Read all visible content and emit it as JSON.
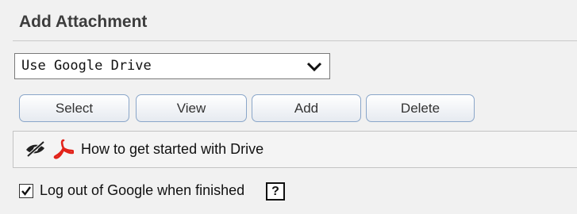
{
  "panel": {
    "title": "Add Attachment"
  },
  "source_select": {
    "value": "Use Google Drive",
    "icon": "chevron-down-icon"
  },
  "buttons": {
    "select": "Select",
    "view": "View",
    "add": "Add",
    "delete": "Delete"
  },
  "files": [
    {
      "name": "How to get started with Drive",
      "icons": [
        "eye-slash-icon",
        "pdf-icon"
      ]
    }
  ],
  "logout": {
    "label": "Log out of Google when finished",
    "checked": true,
    "help": "?"
  },
  "colors": {
    "background": "#f1f1f1",
    "button_border": "#8aa6c9",
    "pdf_red": "#e2231a"
  }
}
